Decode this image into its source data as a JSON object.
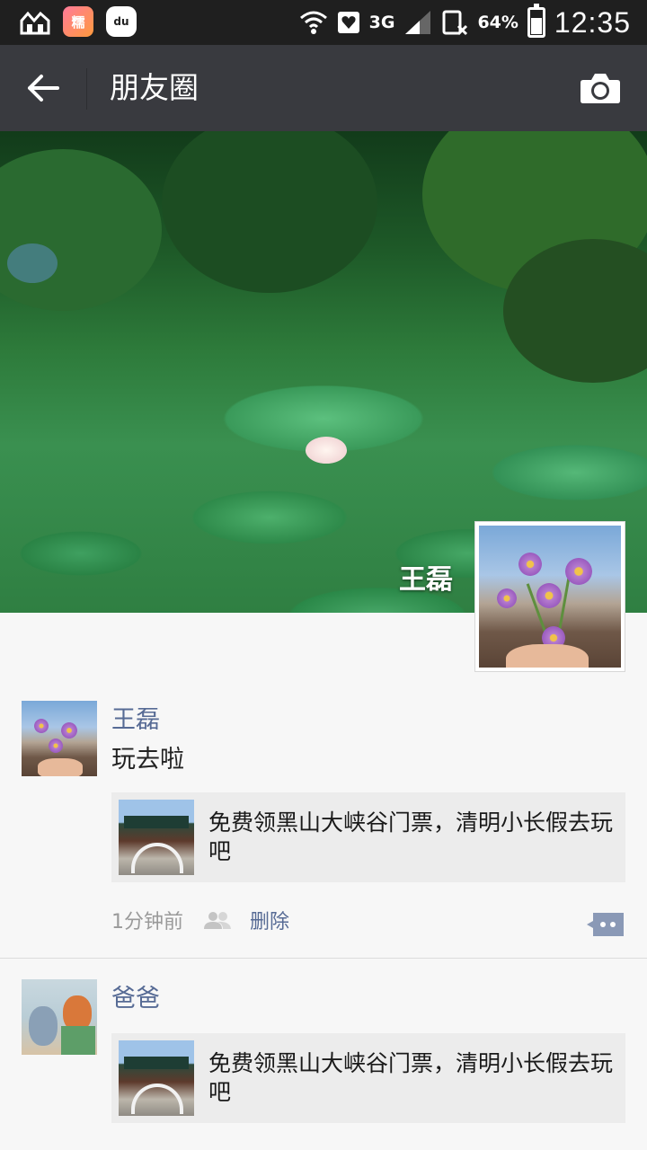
{
  "status_bar": {
    "network": "3G",
    "battery": "64%",
    "battery_level": 0.64,
    "time": "12:35",
    "apps": [
      {
        "name": "home-app-icon",
        "label": ""
      },
      {
        "name": "nuomi-app-icon",
        "label": "糯"
      },
      {
        "name": "du-app-icon",
        "label": "du"
      }
    ]
  },
  "header": {
    "title": "朋友圈",
    "back_icon": "arrow-left-icon",
    "camera_icon": "camera-icon"
  },
  "cover": {
    "user_name": "王磊"
  },
  "posts": [
    {
      "author": "王磊",
      "text": "玩去啦",
      "link": {
        "title": "免费领黑山大峡谷门票，清明小长假去玩吧"
      },
      "time": "1分钟前",
      "privacy_icon": "people-icon",
      "delete_label": "删除",
      "comment_icon": "comment-icon"
    },
    {
      "author": "爸爸",
      "link": {
        "title": "免费领黑山大峡谷门票，清明小长假去玩吧"
      }
    }
  ],
  "colors": {
    "title_bar": "#393a3f",
    "status_bar": "#1f1f1f",
    "name_link": "#576b95",
    "background": "#f7f7f7"
  }
}
